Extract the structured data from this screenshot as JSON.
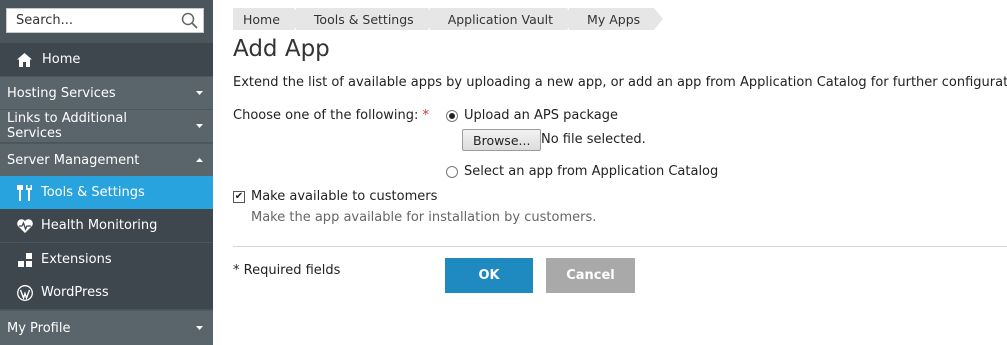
{
  "sidebar": {
    "search_placeholder": "Search...",
    "home": "Home",
    "groups": {
      "hosting": "Hosting Services",
      "links": "Links to Additional Services",
      "server": "Server Management",
      "profile": "My Profile"
    },
    "server_items": [
      "Tools & Settings",
      "Health Monitoring",
      "Extensions",
      "WordPress"
    ],
    "active_color": "#29a3dd"
  },
  "breadcrumbs": [
    "Home",
    "Tools & Settings",
    "Application Vault",
    "My Apps"
  ],
  "page": {
    "title": "Add App",
    "description": "Extend the list of available apps by uploading a new app, or add an app from Application Catalog for further configuration.",
    "choose_label": "Choose one of the following:",
    "required_mark": "*",
    "option_upload": "Upload an APS package",
    "browse_label": "Browse...",
    "no_file": "No file selected.",
    "option_catalog": "Select an app from Application Catalog",
    "checkbox_label": "Make available to customers",
    "checkbox_hint": "Make the app available for installation by customers.",
    "required_fields": "* Required fields",
    "ok_label": "OK",
    "cancel_label": "Cancel",
    "upload_selected": true,
    "make_available_checked": true
  }
}
